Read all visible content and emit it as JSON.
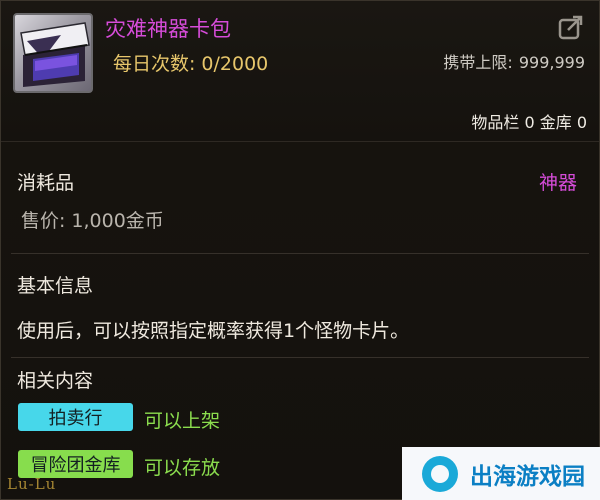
{
  "item": {
    "name": "灾难神器卡包",
    "daily_label": "每日次数:",
    "daily_value": "0/2000",
    "carry_label": "携带上限:",
    "carry_value": "999,999",
    "storage_text": "物品栏 0 金库 0"
  },
  "details": {
    "category": "消耗品",
    "rarity_tag": "神器",
    "price_label": "售价:",
    "price_value": "1,000金币"
  },
  "basic_info": {
    "title": "基本信息",
    "description": "使用后，可以按照指定概率获得1个怪物卡片。"
  },
  "related": {
    "title": "相关内容",
    "items": [
      {
        "button": "拍卖行",
        "note": "可以上架",
        "color": "#47d7ea"
      },
      {
        "button": "冒险团金库",
        "note": "可以存放",
        "color": "#87dd4d"
      }
    ]
  },
  "colors": {
    "item_name": "#d64cd9",
    "daily": "#e7c66b",
    "note": "#8bdd4e"
  },
  "icons": {
    "share": "share-icon",
    "thumb": "card-pack-icon"
  },
  "corner_logo": "Lu-Lu",
  "watermark": {
    "text": "出海游戏园"
  }
}
